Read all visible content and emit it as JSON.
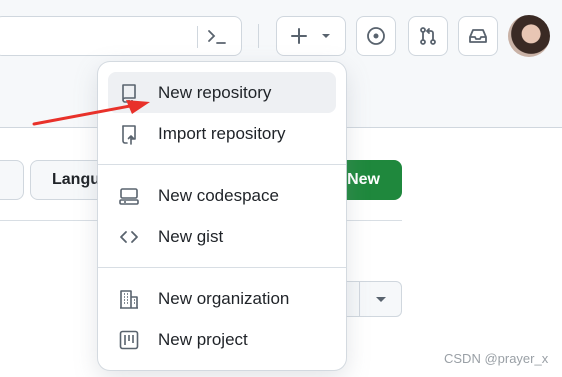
{
  "header": {
    "icons": [
      "command-palette-icon",
      "plus-icon",
      "chevron-down-icon",
      "issues-icon",
      "pull-requests-icon",
      "inbox-icon"
    ]
  },
  "content": {
    "language_label": "Langu",
    "new_button_label": "New"
  },
  "menu": {
    "groups": [
      [
        {
          "label": "New repository",
          "icon": "repo-icon",
          "highlighted": true
        },
        {
          "label": "Import repository",
          "icon": "repo-push-icon"
        }
      ],
      [
        {
          "label": "New codespace",
          "icon": "codespaces-icon"
        },
        {
          "label": "New gist",
          "icon": "code-icon"
        }
      ],
      [
        {
          "label": "New organization",
          "icon": "organization-icon"
        },
        {
          "label": "New project",
          "icon": "project-icon"
        }
      ]
    ]
  },
  "annotation": {
    "color": "#e8312a"
  },
  "watermark": "CSDN @prayer_x",
  "colors": {
    "accent_green": "#1f883d",
    "border": "#d0d7de",
    "highlight": "#eef0f3"
  }
}
